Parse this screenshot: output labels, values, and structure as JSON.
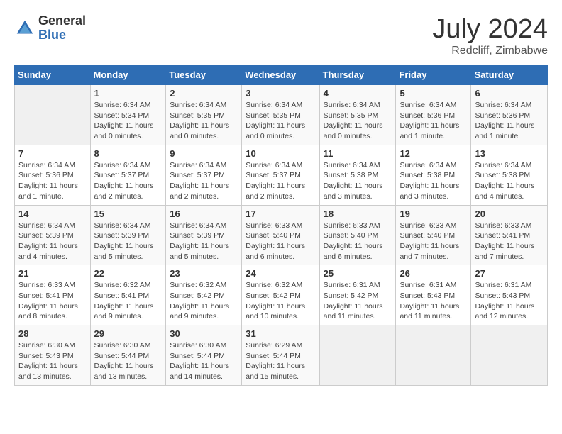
{
  "logo": {
    "general": "General",
    "blue": "Blue"
  },
  "title": "July 2024",
  "subtitle": "Redcliff, Zimbabwe",
  "days_of_week": [
    "Sunday",
    "Monday",
    "Tuesday",
    "Wednesday",
    "Thursday",
    "Friday",
    "Saturday"
  ],
  "weeks": [
    [
      {
        "num": "",
        "detail": ""
      },
      {
        "num": "1",
        "detail": "Sunrise: 6:34 AM\nSunset: 5:34 PM\nDaylight: 11 hours and 0 minutes."
      },
      {
        "num": "2",
        "detail": "Sunrise: 6:34 AM\nSunset: 5:35 PM\nDaylight: 11 hours and 0 minutes."
      },
      {
        "num": "3",
        "detail": "Sunrise: 6:34 AM\nSunset: 5:35 PM\nDaylight: 11 hours and 0 minutes."
      },
      {
        "num": "4",
        "detail": "Sunrise: 6:34 AM\nSunset: 5:35 PM\nDaylight: 11 hours and 0 minutes."
      },
      {
        "num": "5",
        "detail": "Sunrise: 6:34 AM\nSunset: 5:36 PM\nDaylight: 11 hours and 1 minute."
      },
      {
        "num": "6",
        "detail": "Sunrise: 6:34 AM\nSunset: 5:36 PM\nDaylight: 11 hours and 1 minute."
      }
    ],
    [
      {
        "num": "7",
        "detail": "Sunrise: 6:34 AM\nSunset: 5:36 PM\nDaylight: 11 hours and 1 minute."
      },
      {
        "num": "8",
        "detail": "Sunrise: 6:34 AM\nSunset: 5:37 PM\nDaylight: 11 hours and 2 minutes."
      },
      {
        "num": "9",
        "detail": "Sunrise: 6:34 AM\nSunset: 5:37 PM\nDaylight: 11 hours and 2 minutes."
      },
      {
        "num": "10",
        "detail": "Sunrise: 6:34 AM\nSunset: 5:37 PM\nDaylight: 11 hours and 2 minutes."
      },
      {
        "num": "11",
        "detail": "Sunrise: 6:34 AM\nSunset: 5:38 PM\nDaylight: 11 hours and 3 minutes."
      },
      {
        "num": "12",
        "detail": "Sunrise: 6:34 AM\nSunset: 5:38 PM\nDaylight: 11 hours and 3 minutes."
      },
      {
        "num": "13",
        "detail": "Sunrise: 6:34 AM\nSunset: 5:38 PM\nDaylight: 11 hours and 4 minutes."
      }
    ],
    [
      {
        "num": "14",
        "detail": "Sunrise: 6:34 AM\nSunset: 5:39 PM\nDaylight: 11 hours and 4 minutes."
      },
      {
        "num": "15",
        "detail": "Sunrise: 6:34 AM\nSunset: 5:39 PM\nDaylight: 11 hours and 5 minutes."
      },
      {
        "num": "16",
        "detail": "Sunrise: 6:34 AM\nSunset: 5:39 PM\nDaylight: 11 hours and 5 minutes."
      },
      {
        "num": "17",
        "detail": "Sunrise: 6:33 AM\nSunset: 5:40 PM\nDaylight: 11 hours and 6 minutes."
      },
      {
        "num": "18",
        "detail": "Sunrise: 6:33 AM\nSunset: 5:40 PM\nDaylight: 11 hours and 6 minutes."
      },
      {
        "num": "19",
        "detail": "Sunrise: 6:33 AM\nSunset: 5:40 PM\nDaylight: 11 hours and 7 minutes."
      },
      {
        "num": "20",
        "detail": "Sunrise: 6:33 AM\nSunset: 5:41 PM\nDaylight: 11 hours and 7 minutes."
      }
    ],
    [
      {
        "num": "21",
        "detail": "Sunrise: 6:33 AM\nSunset: 5:41 PM\nDaylight: 11 hours and 8 minutes."
      },
      {
        "num": "22",
        "detail": "Sunrise: 6:32 AM\nSunset: 5:41 PM\nDaylight: 11 hours and 9 minutes."
      },
      {
        "num": "23",
        "detail": "Sunrise: 6:32 AM\nSunset: 5:42 PM\nDaylight: 11 hours and 9 minutes."
      },
      {
        "num": "24",
        "detail": "Sunrise: 6:32 AM\nSunset: 5:42 PM\nDaylight: 11 hours and 10 minutes."
      },
      {
        "num": "25",
        "detail": "Sunrise: 6:31 AM\nSunset: 5:42 PM\nDaylight: 11 hours and 11 minutes."
      },
      {
        "num": "26",
        "detail": "Sunrise: 6:31 AM\nSunset: 5:43 PM\nDaylight: 11 hours and 11 minutes."
      },
      {
        "num": "27",
        "detail": "Sunrise: 6:31 AM\nSunset: 5:43 PM\nDaylight: 11 hours and 12 minutes."
      }
    ],
    [
      {
        "num": "28",
        "detail": "Sunrise: 6:30 AM\nSunset: 5:43 PM\nDaylight: 11 hours and 13 minutes."
      },
      {
        "num": "29",
        "detail": "Sunrise: 6:30 AM\nSunset: 5:44 PM\nDaylight: 11 hours and 13 minutes."
      },
      {
        "num": "30",
        "detail": "Sunrise: 6:30 AM\nSunset: 5:44 PM\nDaylight: 11 hours and 14 minutes."
      },
      {
        "num": "31",
        "detail": "Sunrise: 6:29 AM\nSunset: 5:44 PM\nDaylight: 11 hours and 15 minutes."
      },
      {
        "num": "",
        "detail": ""
      },
      {
        "num": "",
        "detail": ""
      },
      {
        "num": "",
        "detail": ""
      }
    ]
  ]
}
